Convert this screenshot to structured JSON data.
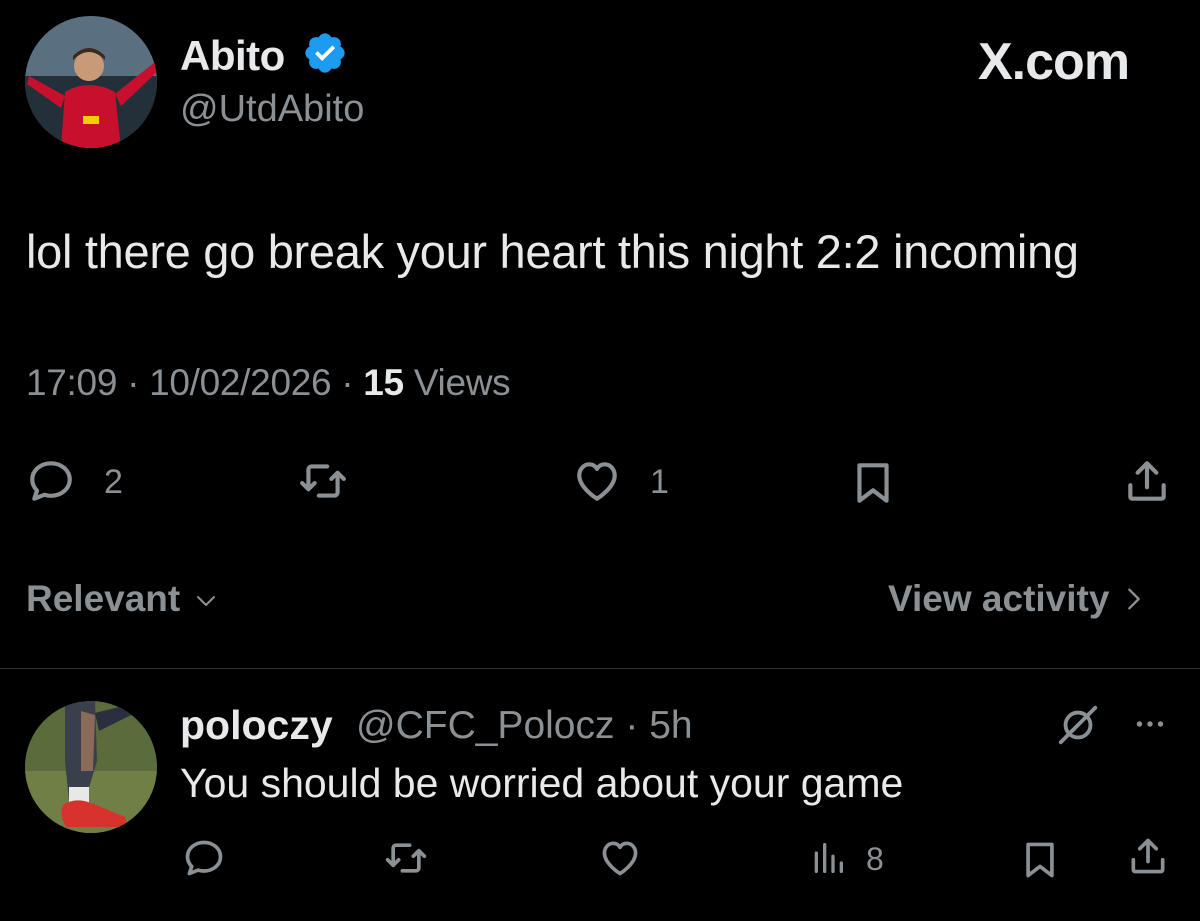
{
  "tweet": {
    "author_name": "Abito",
    "author_handle": "@UtdAbito",
    "brand": "X.com",
    "text": "lol there go break your heart this night 2:2 incoming",
    "time": "17:09",
    "date": "10/02/2026",
    "separator": "·",
    "views_count": "15",
    "views_label": "Views",
    "replies": "2",
    "likes": "1"
  },
  "controls": {
    "sort_label": "Relevant",
    "view_activity_label": "View activity"
  },
  "reply": {
    "author_name": "poloczy",
    "author_handle": "@CFC_Polocz",
    "separator": "·",
    "age": "5h",
    "text": "You should be worried about your game",
    "views": "8"
  },
  "colors": {
    "background": "#000000",
    "text_primary": "#e7e9ea",
    "text_secondary": "#8b9095",
    "verified_blue": "#1d9bf0",
    "divider": "#2f3336"
  },
  "icons": {
    "reply": "reply-icon",
    "retweet": "retweet-icon",
    "like": "heart-icon",
    "bookmark": "bookmark-icon",
    "share": "share-icon",
    "views": "views-icon",
    "verified": "verified-badge-icon",
    "grok": "grok-icon",
    "more": "more-icon"
  }
}
